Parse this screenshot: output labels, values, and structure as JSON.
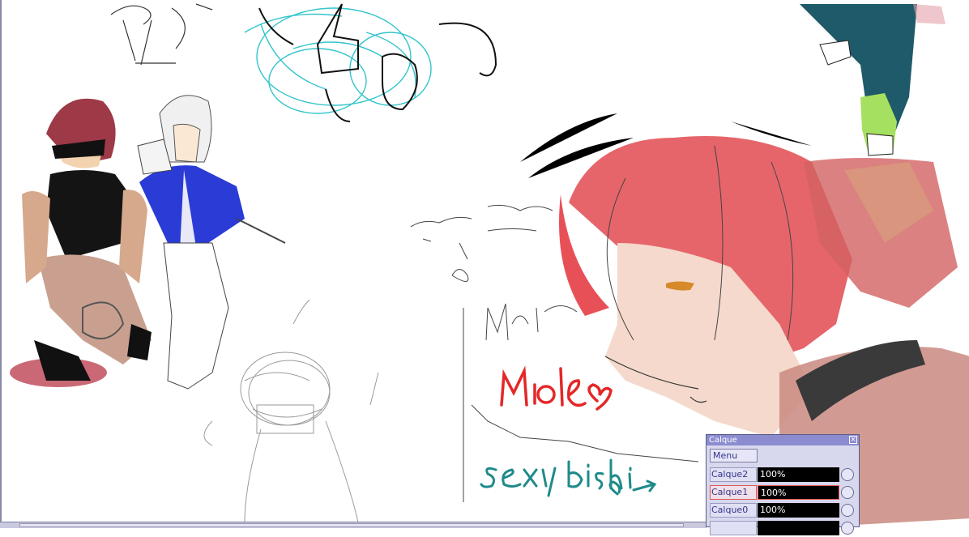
{
  "canvas": {
    "handwritten_notes": [
      "Miole",
      "sexy bishi"
    ]
  },
  "layer_panel": {
    "title": "Calque",
    "close_icon": "close-icon",
    "menu_label": "Menu",
    "layers": [
      {
        "name": "Calque2",
        "opacity": "100%",
        "active": false
      },
      {
        "name": "Calque1",
        "opacity": "100%",
        "active": true
      },
      {
        "name": "Calque0",
        "opacity": "100%",
        "active": false
      },
      {
        "name": "",
        "opacity": "",
        "active": false
      }
    ]
  },
  "colors": {
    "panel_bg": "#d7d7ee",
    "panel_title": "#8b8bd0",
    "active_layer": "#e05858"
  }
}
